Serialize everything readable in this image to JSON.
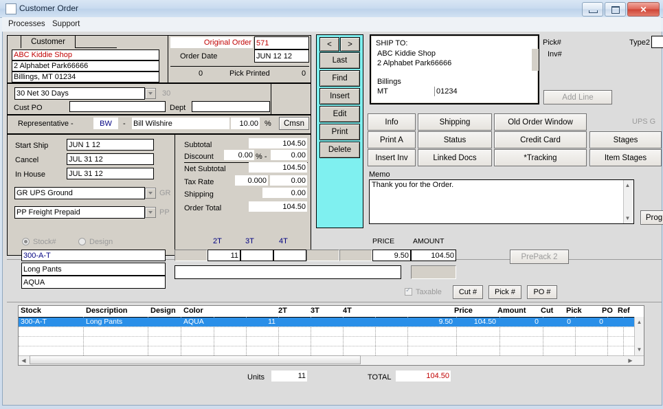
{
  "window": {
    "title": "Customer Order",
    "icon": "window-icon",
    "buttons": {
      "minimize": "minimize",
      "maximize": "maximize",
      "close": "close"
    }
  },
  "menubar": {
    "items": [
      "Processes",
      "Support"
    ]
  },
  "customer": {
    "tab_label": "Customer",
    "name": "ABC Kiddie Shop",
    "address": "2 Alphabet Park66666",
    "city_state_zip": "Billings, MT 01234"
  },
  "order": {
    "original_order_label": "Original Order",
    "original_order": "571",
    "order_date_label": "Order Date",
    "order_date": "JUN 12 12",
    "printed_count": "0",
    "pick_printed_label": "Pick Printed",
    "pick_printed": "0"
  },
  "terms": {
    "value": "30   Net 30 Days",
    "code": "30",
    "cust_po_label": "Cust PO",
    "cust_po": "",
    "dept_label": "Dept",
    "dept": ""
  },
  "representative": {
    "label": "Representative -",
    "initials": "BW",
    "dash": "-",
    "name": "Bill Wilshire",
    "pct": "10.00",
    "pct_sign": "%",
    "cmsn_button": "Cmsn"
  },
  "dates": {
    "start_ship_label": "Start Ship",
    "start_ship": "JUN 1 12",
    "cancel_label": "Cancel",
    "cancel": "JUL 31 12",
    "in_house_label": "In House",
    "in_house": "JUL 31 12"
  },
  "shipping_method": {
    "carrier": "GR   UPS Ground",
    "carrier_code": "GR",
    "terms": "PP   Freight Prepaid",
    "terms_code": "PP"
  },
  "totals": {
    "subtotal_label": "Subtotal",
    "subtotal": "104.50",
    "discount_label": "Discount",
    "discount_pct": "0.00",
    "discount_sign": "% -",
    "discount_amt": "0.00",
    "net_subtotal_label": "Net Subtotal",
    "net_subtotal": "104.50",
    "tax_rate_label": "Tax Rate",
    "tax_rate": "0.000",
    "tax_amt": "0.00",
    "shipping_label": "Shipping",
    "shipping": "0.00",
    "order_total_label": "Order Total",
    "order_total": "104.50"
  },
  "nav": {
    "prev": "<",
    "next": ">",
    "buttons": [
      "Last",
      "Find",
      "Insert",
      "Edit",
      "Print",
      "Delete"
    ]
  },
  "shipto": {
    "title": "SHIP TO:",
    "name": "ABC Kiddie Shop",
    "address": "2 Alphabet Park66666",
    "city": "Billings",
    "state": "MT",
    "zip": "01234"
  },
  "actions": {
    "col1": [
      "Info",
      "Print A",
      "Insert Inv"
    ],
    "col2": [
      "Shipping",
      "Status",
      "Linked Docs"
    ],
    "col3": [
      "Old Order Window",
      "Credit Card",
      "*Tracking"
    ],
    "col4": [
      "Stages",
      "Item Stages"
    ],
    "ups_label": "UPS G",
    "prog_button": "Prog"
  },
  "memo": {
    "label": "Memo",
    "text": "Thank you for the Order."
  },
  "right_panel": {
    "pick_label": "Pick#",
    "pick_value": "",
    "inv_label": "Inv#",
    "inv_value": "",
    "type2_label": "Type2",
    "type2_value": "",
    "add_line_button": "Add Line"
  },
  "item_entry": {
    "stock_radio_label": "Stock#",
    "design_radio_label": "Design",
    "stock_selected": true,
    "stock_value": "300-A-T",
    "description": "Long Pants",
    "color": "AQUA",
    "size_headers": [
      "2T",
      "3T",
      "4T"
    ],
    "qty_values": [
      "",
      "11",
      "",
      "",
      "",
      ""
    ],
    "price_label": "PRICE",
    "amount_label": "AMOUNT",
    "price": "9.50",
    "amount": "104.50",
    "notes": "",
    "taxable_label": "Taxable",
    "taxable_checked": true,
    "prepack_button": "PrePack 2",
    "cut_button": "Cut #",
    "pick_button": "Pick #",
    "po_button": "PO #"
  },
  "grid": {
    "columns": [
      "Stock",
      "Description",
      "Design",
      "Color",
      "",
      "2T",
      "3T",
      "4T",
      "",
      "",
      "Price",
      "Amount",
      "Cut",
      "Pick",
      "PO",
      "Ref"
    ],
    "rows": [
      {
        "selected": true,
        "cells": [
          "300-A-T",
          "Long Pants",
          "",
          "AQUA",
          "",
          "11",
          "",
          "",
          "",
          "",
          "9.50",
          "104.50",
          "0",
          "0",
          "0",
          ""
        ]
      }
    ],
    "empty_rows": 3
  },
  "footer": {
    "units_label": "Units",
    "units": "11",
    "total_label": "TOTAL",
    "total": "104.50"
  },
  "colors": {
    "accent_cyan": "#7ff0f0",
    "select_blue": "#2a8fe8",
    "red_text": "#c00000",
    "blue_text": "#000080",
    "face": "#d4d0c8"
  }
}
